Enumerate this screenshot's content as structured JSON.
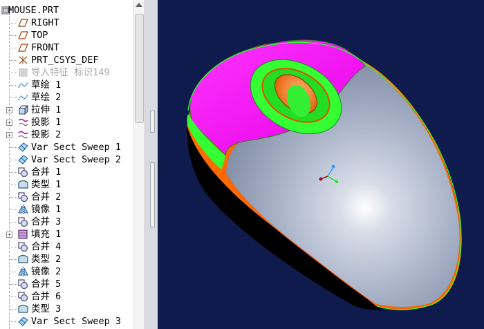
{
  "model_tree": {
    "root": "MOUSE.PRT",
    "items": [
      {
        "label": "RIGHT",
        "icon": "datum-plane-icon",
        "expandable": false
      },
      {
        "label": "TOP",
        "icon": "datum-plane-icon",
        "expandable": false
      },
      {
        "label": "FRONT",
        "icon": "datum-plane-icon",
        "expandable": false
      },
      {
        "label": "PRT_CSYS_DEF",
        "icon": "coordinate-system-icon",
        "expandable": false
      },
      {
        "label": "导入特征 标识149",
        "icon": "import-feature-icon",
        "expandable": false,
        "suppressed": true
      },
      {
        "label": "草绘 1",
        "icon": "sketch-icon",
        "expandable": false
      },
      {
        "label": "草绘 2",
        "icon": "sketch-icon",
        "expandable": false
      },
      {
        "label": "拉伸 1",
        "icon": "extrude-icon",
        "expandable": true
      },
      {
        "label": "投影 1",
        "icon": "projection-icon",
        "expandable": true
      },
      {
        "label": "投影 2",
        "icon": "projection-icon",
        "expandable": true
      },
      {
        "label": "Var Sect Sweep 1",
        "icon": "sweep-icon",
        "expandable": false
      },
      {
        "label": "Var Sect Sweep 2",
        "icon": "sweep-icon",
        "expandable": false
      },
      {
        "label": "合并 1",
        "icon": "merge-icon",
        "expandable": false
      },
      {
        "label": "类型 1",
        "icon": "surface-type-icon",
        "expandable": false
      },
      {
        "label": "合并 2",
        "icon": "merge-icon",
        "expandable": false
      },
      {
        "label": "镜像 1",
        "icon": "mirror-icon",
        "expandable": false
      },
      {
        "label": "合并 3",
        "icon": "merge-icon",
        "expandable": false
      },
      {
        "label": "填充 1",
        "icon": "fill-icon",
        "expandable": true
      },
      {
        "label": "合并 4",
        "icon": "merge-icon",
        "expandable": false
      },
      {
        "label": "类型 2",
        "icon": "surface-type-icon",
        "expandable": false
      },
      {
        "label": "镜像 2",
        "icon": "mirror-icon",
        "expandable": false
      },
      {
        "label": "合并 5",
        "icon": "merge-icon",
        "expandable": false
      },
      {
        "label": "合并 6",
        "icon": "merge-icon",
        "expandable": false
      },
      {
        "label": "类型 3",
        "icon": "surface-type-icon",
        "expandable": false
      },
      {
        "label": "Var Sect Sweep 3",
        "icon": "sweep-icon",
        "expandable": false
      }
    ]
  },
  "viewport": {
    "background": "#0f1a4d",
    "model": "mouse-3d-model",
    "colors": {
      "body": "#a9b4c8",
      "top_shell": "#ff00ff",
      "bottom_shell": "#000000",
      "edge_band": "#ff6a00",
      "ring": "#00ff00",
      "scroll_wheel": "#ff6a00"
    }
  }
}
